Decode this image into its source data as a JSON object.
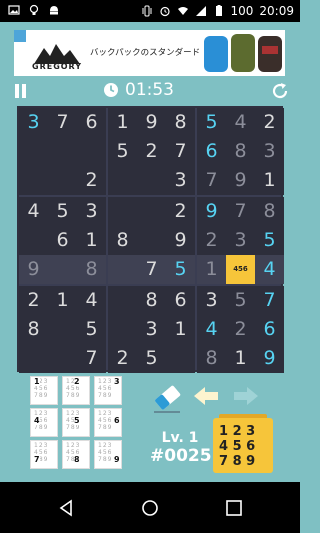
{
  "status_bar": {
    "time": "20:09",
    "battery": "100",
    "left_icons": [
      "image-icon",
      "bulb-icon",
      "android-icon"
    ],
    "right_icons": [
      "vibrate-icon",
      "alarm-icon",
      "wifi-icon",
      "signal-icon",
      "battery-icon"
    ]
  },
  "ad": {
    "brand": "GREGORY",
    "text": "バックパックのスタンダード"
  },
  "game": {
    "timer": "01:53",
    "level_label": "Lv. 1",
    "puzzle_number": "#0025",
    "selected_cell_candidates": "456",
    "colors": {
      "bg": "#7fc0c3",
      "cell": "#2d2e3b",
      "given": "#dcdcdc",
      "entered": "#57d3f2",
      "accent": "#f6c53a"
    }
  },
  "grid": {
    "rows": [
      [
        "3",
        "7",
        "6",
        "1",
        "9",
        "8",
        "5",
        "4",
        "2"
      ],
      [
        "",
        "",
        "",
        "5",
        "2",
        "7",
        "6",
        "8",
        "3"
      ],
      [
        "",
        "",
        "2",
        "",
        "",
        "3",
        "7",
        "9",
        "1"
      ],
      [
        "4",
        "5",
        "3",
        "",
        "",
        "2",
        "9",
        "7",
        "8"
      ],
      [
        "",
        "6",
        "1",
        "8",
        "",
        "9",
        "2",
        "3",
        "5"
      ],
      [
        "9",
        "",
        "8",
        "",
        "7",
        "5",
        "1",
        "456",
        "4"
      ],
      [
        "2",
        "1",
        "4",
        "",
        "8",
        "6",
        "3",
        "5",
        "7"
      ],
      [
        "8",
        "",
        "5",
        "",
        "3",
        "1",
        "4",
        "2",
        "6"
      ],
      [
        "",
        "",
        "7",
        "2",
        "5",
        "",
        "8",
        "1",
        "9"
      ]
    ],
    "blue": [
      [
        0,
        0
      ],
      [
        0,
        6
      ],
      [
        1,
        6
      ],
      [
        3,
        6
      ],
      [
        4,
        8
      ],
      [
        5,
        5
      ],
      [
        5,
        8
      ],
      [
        6,
        8
      ],
      [
        7,
        6
      ],
      [
        7,
        8
      ],
      [
        8,
        8
      ]
    ],
    "gray": [
      [
        0,
        7
      ],
      [
        1,
        7
      ],
      [
        1,
        8
      ],
      [
        2,
        6
      ],
      [
        2,
        7
      ],
      [
        3,
        7
      ],
      [
        3,
        8
      ],
      [
        4,
        6
      ],
      [
        4,
        7
      ],
      [
        5,
        0
      ],
      [
        5,
        2
      ],
      [
        5,
        6
      ],
      [
        6,
        7
      ],
      [
        7,
        7
      ],
      [
        8,
        6
      ]
    ],
    "highlight_row": 5,
    "highlight_col": 7,
    "selected": [
      5,
      7
    ]
  },
  "notes_panel": {
    "digits": [
      "123",
      "456",
      "789"
    ],
    "tiles": [
      {
        "big": "1"
      },
      {
        "big": "2"
      },
      {
        "big": "3"
      },
      {
        "big": "4"
      },
      {
        "big": "5"
      },
      {
        "big": "6"
      },
      {
        "big": "7"
      },
      {
        "big": "8"
      },
      {
        "big": "9"
      }
    ]
  },
  "keypad": {
    "rows": [
      "1 2 3",
      "4 5 6",
      "7 8 9"
    ]
  }
}
